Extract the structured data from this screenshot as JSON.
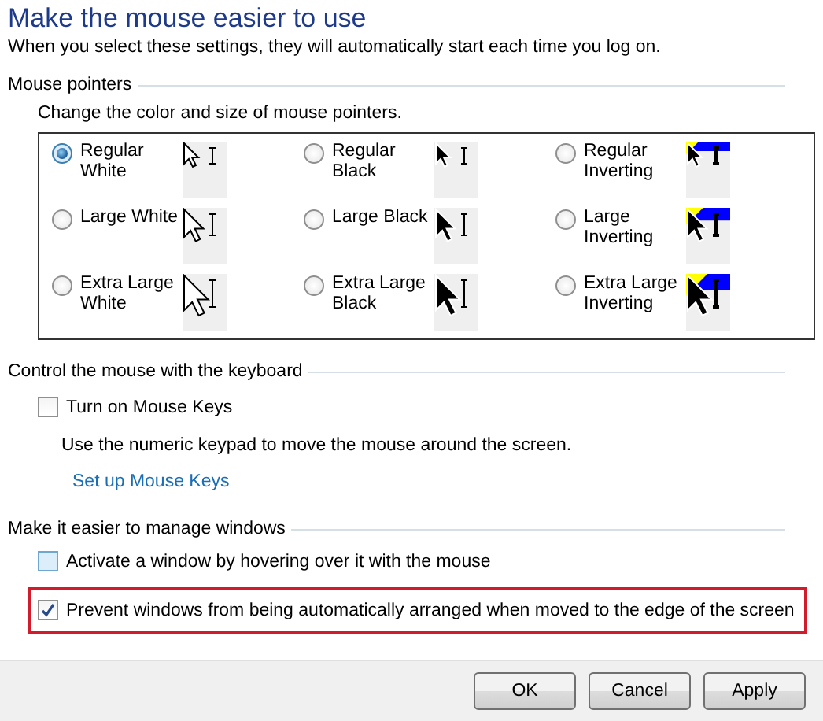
{
  "heading": {
    "title": "Make the mouse easier to use",
    "subtitle": "When you select these settings, they will automatically start each time you log on."
  },
  "pointers": {
    "title": "Mouse pointers",
    "description": "Change the color and size of mouse pointers.",
    "options": [
      {
        "label": "Regular White",
        "kind": "white",
        "selected": true
      },
      {
        "label": "Regular Black",
        "kind": "black",
        "selected": false
      },
      {
        "label": "Regular Inverting",
        "kind": "inverting",
        "selected": false
      },
      {
        "label": "Large White",
        "kind": "white",
        "selected": false
      },
      {
        "label": "Large Black",
        "kind": "black",
        "selected": false
      },
      {
        "label": "Large Inverting",
        "kind": "inverting",
        "selected": false
      },
      {
        "label": "Extra Large White",
        "kind": "white",
        "selected": false
      },
      {
        "label": "Extra Large Black",
        "kind": "black",
        "selected": false
      },
      {
        "label": "Extra Large Inverting",
        "kind": "inverting",
        "selected": false
      }
    ]
  },
  "keyboard": {
    "title": "Control the mouse with the keyboard",
    "checkbox": {
      "label": "Turn on Mouse Keys",
      "checked": false
    },
    "description": "Use the numeric keypad to move the mouse around the screen.",
    "link": "Set up Mouse Keys"
  },
  "windows": {
    "title": "Make it easier to manage windows",
    "checkboxes": [
      {
        "label": "Activate a window by hovering over it with the mouse",
        "checked": false,
        "highlighted": false
      },
      {
        "label": "Prevent windows from being automatically arranged when moved to the edge of the screen",
        "checked": true,
        "highlighted": true
      }
    ]
  },
  "buttons": [
    "OK",
    "Cancel",
    "Apply"
  ]
}
